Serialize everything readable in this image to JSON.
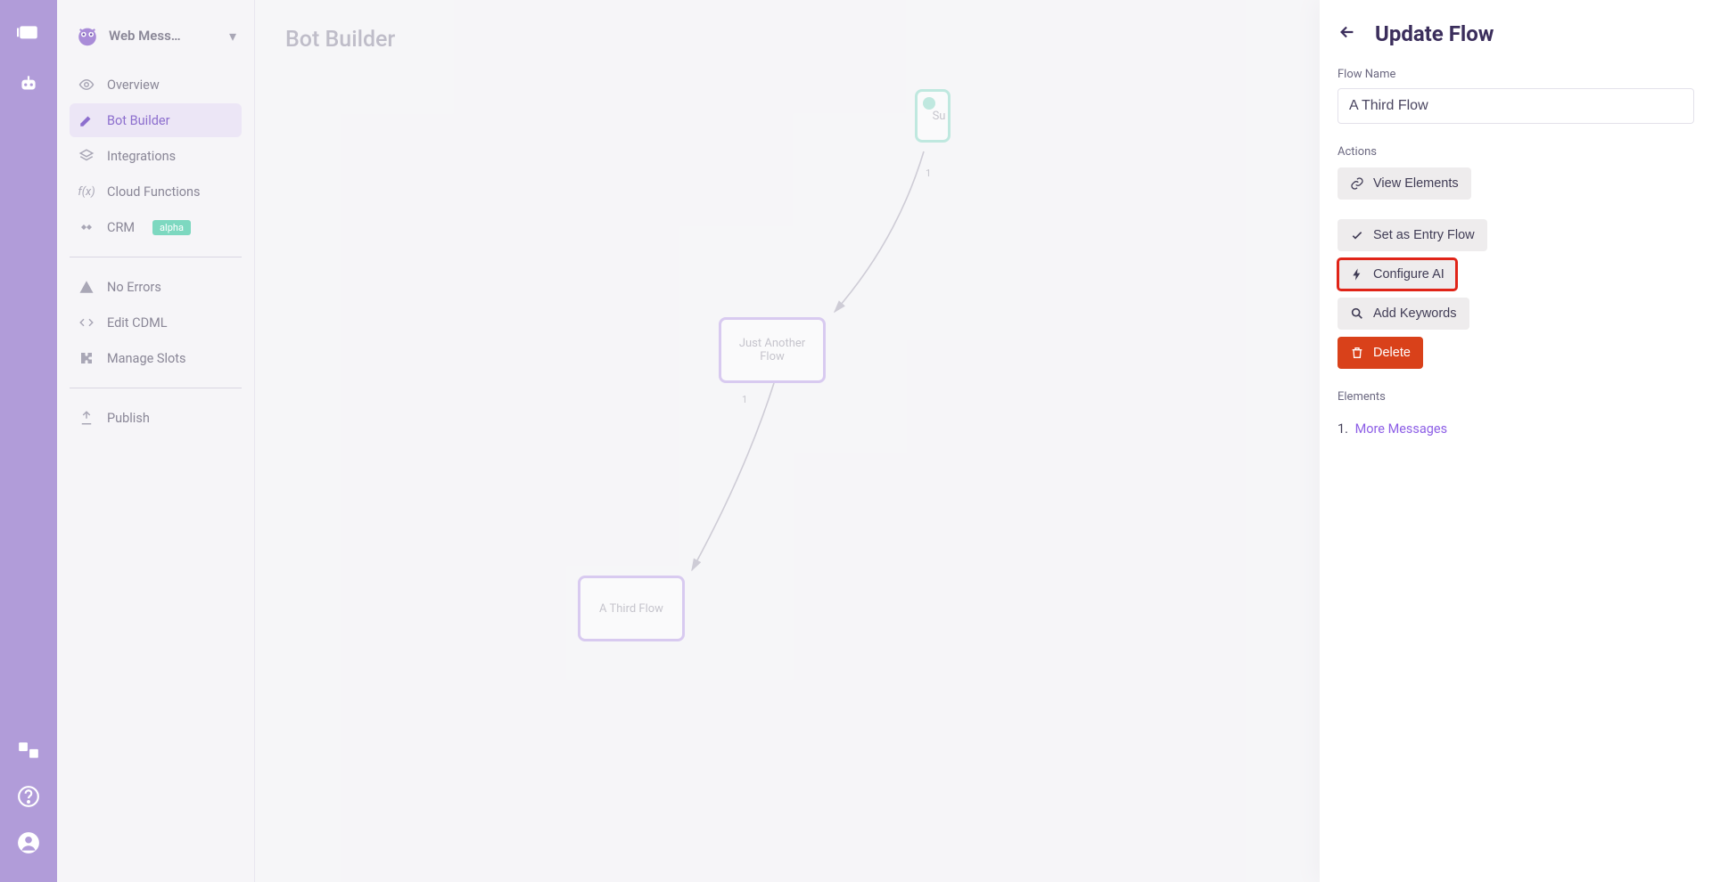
{
  "rail": {
    "top_icons": [
      "chat-icon",
      "bot-icon"
    ],
    "bottom_icons": [
      "translate-icon",
      "help-icon",
      "account-icon"
    ]
  },
  "sidebar": {
    "title": "Web Mess…",
    "items": [
      {
        "icon": "eye-icon",
        "label": "Overview"
      },
      {
        "icon": "pencil-icon",
        "label": "Bot Builder",
        "active": true
      },
      {
        "icon": "layers-icon",
        "label": "Integrations"
      },
      {
        "icon": "function-icon",
        "label": "Cloud Functions"
      },
      {
        "icon": "handshake-icon",
        "label": "CRM",
        "badge": "alpha"
      }
    ],
    "items2": [
      {
        "icon": "warning-icon",
        "label": "No Errors"
      },
      {
        "icon": "code-icon",
        "label": "Edit CDML"
      },
      {
        "icon": "puzzle-icon",
        "label": "Manage Slots"
      }
    ],
    "items3": [
      {
        "icon": "publish-icon",
        "label": "Publish"
      }
    ]
  },
  "page": {
    "title": "Bot Builder"
  },
  "flows": {
    "nodes": {
      "top": {
        "label": "Su"
      },
      "middle": {
        "label_line1": "Just Another",
        "label_line2": "Flow"
      },
      "bottom": {
        "label": "A Third Flow"
      }
    },
    "edge_labels": {
      "top_mid": "1",
      "mid_bottom": "1"
    }
  },
  "panel": {
    "title": "Update Flow",
    "flow_name_label": "Flow Name",
    "flow_name_value": "A Third Flow",
    "actions_label": "Actions",
    "view_elements": "View Elements",
    "secondary_actions": {
      "set_entry": "Set as Entry Flow",
      "configure_ai": "Configure AI",
      "add_keywords": "Add Keywords",
      "delete": "Delete"
    },
    "elements_label": "Elements",
    "elements": [
      {
        "num": "1.",
        "label": "More Messages"
      }
    ]
  }
}
